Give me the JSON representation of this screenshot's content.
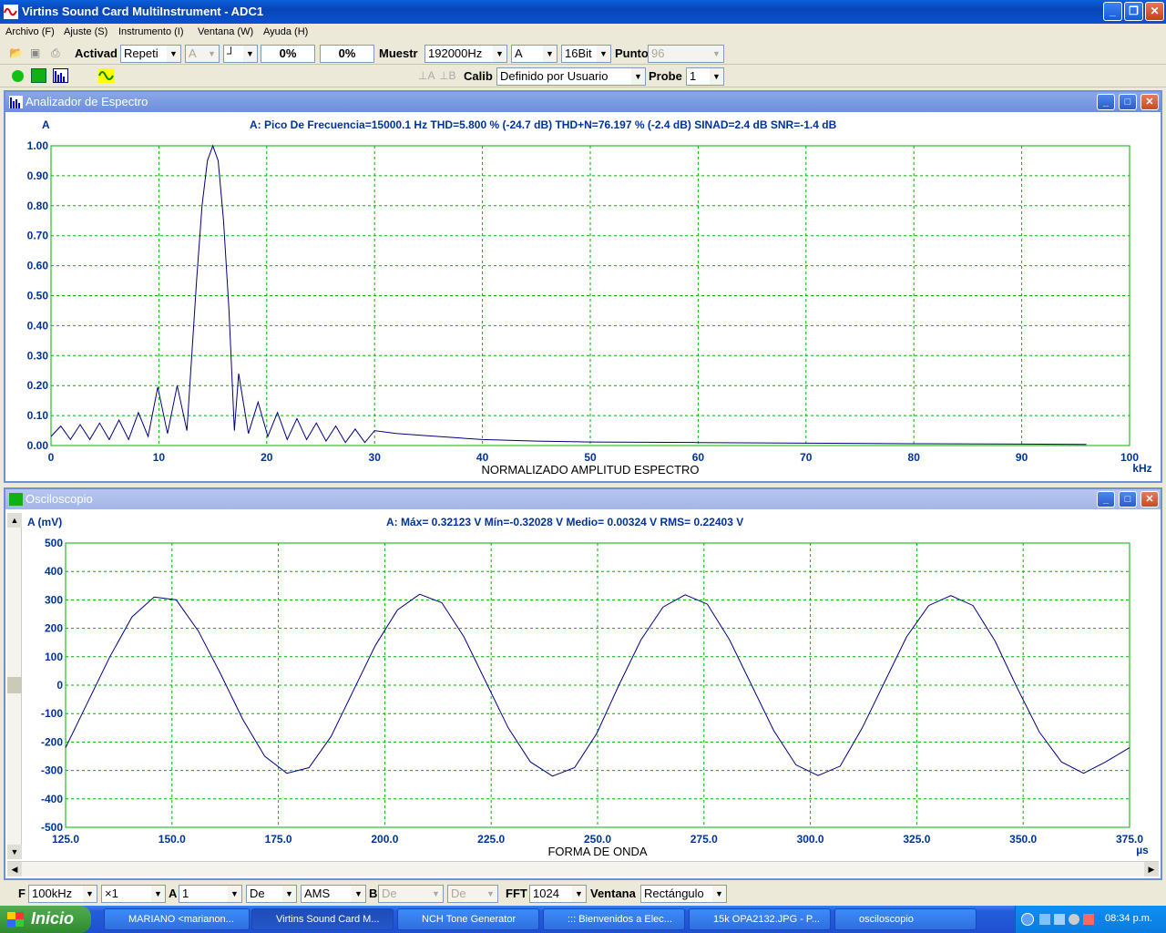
{
  "window": {
    "title": "Virtins Sound Card MultiInstrument - ADC1"
  },
  "menu": [
    "Archivo (F)",
    "Ajuste (S)",
    "Instrumento (I)",
    "Ventana (W)",
    "Ayuda (H)"
  ],
  "toolbar1": {
    "activad_label": "Activad",
    "mode_value": "Repeti",
    "chan_value": "A",
    "trig_value": "┘",
    "pct1": "0%",
    "pct2": "0%",
    "muestr_label": "Muestr",
    "rate_value": "192000Hz",
    "channel_value": "A",
    "bits_value": "16Bit",
    "punto_label": "Punto",
    "punto_value": "96"
  },
  "toolbar2": {
    "calib_label": "Calib",
    "calib_value": "Definido por Usuario",
    "probe_label": "Probe",
    "probe_value": "1",
    "a_glyph": "⊥A",
    "b_glyph": "⊥B"
  },
  "spectrum": {
    "title": "Analizador de Espectro",
    "channel": "A",
    "info": "A: Pico De Frecuencia=15000.1 Hz  THD=5.800 % (-24.7 dB)  THD+N=76.197 % (-2.4 dB)  SINAD=2.4 dB SNR=-1.4 dB",
    "xlabel": "NORMALIZADO AMPLITUD ESPECTRO",
    "xunit": "kHz"
  },
  "scope": {
    "title": "Osciloscopio",
    "ylabel": "A (mV)",
    "info": "A: Máx= 0.32123 V  Mín=-0.32028 V  Medio= 0.00324 V  RMS= 0.22403 V",
    "xlabel": "FORMA DE ONDA",
    "xunit": "µs"
  },
  "chart_data": [
    {
      "type": "line",
      "name": "spectrum",
      "xlim": [
        0,
        100
      ],
      "ylim": [
        0,
        1
      ],
      "xticks": [
        "0",
        "10",
        "20",
        "30",
        "40",
        "50",
        "60",
        "70",
        "80",
        "90",
        "100"
      ],
      "yticks": [
        "0.00",
        "0.10",
        "0.20",
        "0.30",
        "0.40",
        "0.50",
        "0.60",
        "0.70",
        "0.80",
        "0.90",
        "1.00"
      ],
      "grid": true,
      "color": "#000080",
      "peak_khz": 15.0,
      "x": [
        0,
        0.9,
        1.8,
        2.7,
        3.6,
        4.5,
        5.4,
        6.3,
        7.2,
        8.1,
        9.0,
        9.9,
        10.8,
        11.7,
        12.6,
        13.5,
        14.0,
        14.5,
        15.0,
        15.5,
        16.0,
        16.5,
        17.0,
        17.4,
        18.3,
        19.2,
        20.1,
        21.0,
        21.9,
        22.8,
        23.7,
        24.6,
        25.5,
        26.4,
        27.3,
        28.2,
        29.1,
        30.0,
        32,
        34,
        36,
        38,
        40,
        45,
        50,
        60,
        70,
        80,
        90,
        96
      ],
      "y": [
        0.03,
        0.065,
        0.02,
        0.07,
        0.02,
        0.075,
        0.02,
        0.085,
        0.02,
        0.11,
        0.03,
        0.195,
        0.04,
        0.2,
        0.05,
        0.55,
        0.8,
        0.95,
        1.0,
        0.95,
        0.75,
        0.45,
        0.05,
        0.24,
        0.04,
        0.145,
        0.03,
        0.11,
        0.02,
        0.09,
        0.02,
        0.075,
        0.015,
        0.065,
        0.01,
        0.055,
        0.01,
        0.05,
        0.04,
        0.035,
        0.03,
        0.025,
        0.02,
        0.015,
        0.012,
        0.01,
        0.008,
        0.006,
        0.005,
        0.004
      ]
    },
    {
      "type": "line",
      "name": "waveform",
      "xlim": [
        125,
        375
      ],
      "ylim": [
        -500,
        500
      ],
      "xticks": [
        "125.0",
        "150.0",
        "175.0",
        "200.0",
        "225.0",
        "250.0",
        "275.0",
        "300.0",
        "325.0",
        "350.0",
        "375.0"
      ],
      "yticks": [
        "500",
        "400",
        "300",
        "200",
        "100",
        "0",
        "-100",
        "-200",
        "-300",
        "-400",
        "-500"
      ],
      "grid": true,
      "color": "#000080",
      "x": [
        125,
        130.2,
        135.4,
        140.6,
        145.8,
        151.0,
        156.2,
        161.4,
        166.6,
        171.8,
        177.0,
        182.2,
        187.4,
        192.6,
        197.8,
        203.0,
        208.2,
        213.4,
        218.6,
        223.8,
        229.0,
        234.2,
        239.4,
        244.6,
        249.8,
        255.0,
        260.2,
        265.4,
        270.6,
        275.8,
        281.0,
        286.2,
        291.4,
        296.6,
        301.8,
        307.0,
        312.2,
        317.4,
        322.6,
        327.8,
        333.0,
        338.2,
        343.4,
        348.6,
        353.8,
        359.0,
        364.2,
        369.4,
        375
      ],
      "y": [
        -220,
        -60,
        100,
        240,
        310,
        300,
        190,
        40,
        -120,
        -250,
        -310,
        -290,
        -180,
        -20,
        140,
        265,
        320,
        290,
        170,
        10,
        -150,
        -270,
        -320,
        -290,
        -170,
        0,
        160,
        275,
        318,
        285,
        160,
        0,
        -160,
        -280,
        -318,
        -285,
        -150,
        10,
        170,
        280,
        315,
        280,
        155,
        -10,
        -165,
        -270,
        -310,
        -270,
        -220
      ]
    }
  ],
  "status": {
    "f_label": "F",
    "f_value": "100kHz",
    "mult_value": "×1",
    "a_label": "A",
    "a_value": "1",
    "de1_value": "De",
    "ams_value": "AMS",
    "b_label": "B",
    "b_value": "De",
    "de2_value": "De",
    "fft_label": "FFT",
    "fft_value": "1024",
    "ventana_label": "Ventana",
    "ventana_value": "Rectángulo"
  },
  "taskbar": {
    "start": "Inicio",
    "tasks": [
      "MARIANO <marianon...",
      "Virtins Sound Card M...",
      "NCH Tone Generator",
      "::: Bienvenidos a Elec...",
      "15k OPA2132.JPG - P...",
      "osciloscopio"
    ],
    "clock": "08:34 p.m."
  }
}
